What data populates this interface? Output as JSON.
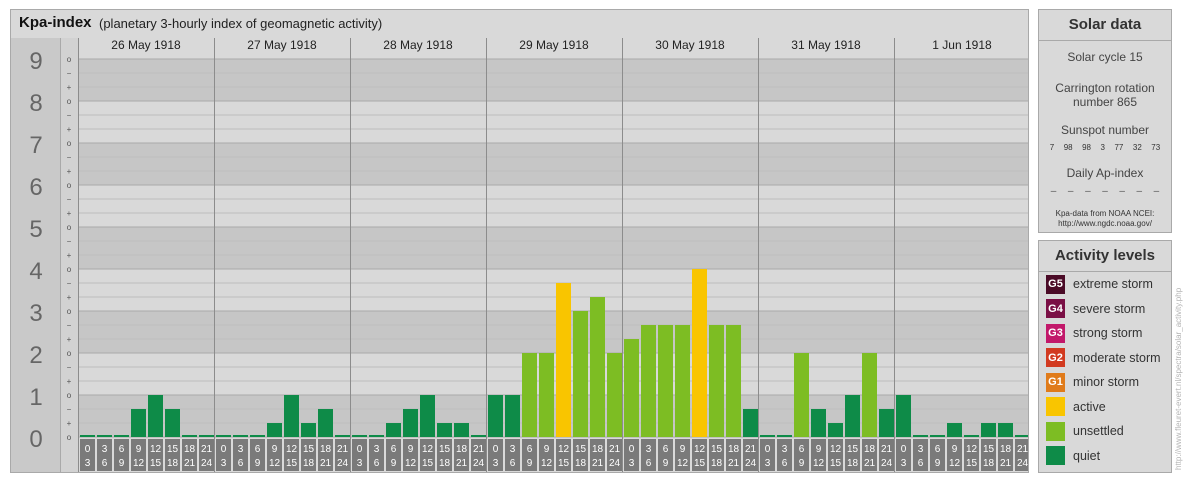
{
  "header": {
    "title": "Kpa-index",
    "subtitle": "(planetary 3-hourly index of geomagnetic activity)"
  },
  "chart_data": {
    "type": "bar",
    "title": "Kpa-index",
    "subtitle": "(planetary 3-hourly index of geomagnetic activity)",
    "ylim": [
      0,
      9
    ],
    "y_ticks": [
      "0",
      "1",
      "2",
      "3",
      "4",
      "5",
      "6",
      "7",
      "8",
      "9"
    ],
    "y_minor_ticks": [
      "o",
      "+",
      "−"
    ],
    "days": [
      "26 May 1918",
      "27 May 1918",
      "28 May 1918",
      "29 May 1918",
      "30 May 1918",
      "31 May 1918",
      "1 Jun 1918"
    ],
    "interval_labels": [
      [
        "0",
        "3"
      ],
      [
        "3",
        "6"
      ],
      [
        "6",
        "9"
      ],
      [
        "9",
        "12"
      ],
      [
        "12",
        "15"
      ],
      [
        "15",
        "18"
      ],
      [
        "18",
        "21"
      ],
      [
        "21",
        "24"
      ]
    ],
    "values": [
      [
        0,
        0,
        0,
        0.667,
        1,
        0.667,
        0,
        0
      ],
      [
        0,
        0,
        0,
        0.333,
        1,
        0.333,
        0.667,
        0
      ],
      [
        0,
        0,
        0.333,
        0.667,
        1,
        0.333,
        0.333,
        0
      ],
      [
        1,
        1,
        2,
        2,
        3.667,
        3,
        3.333,
        2
      ],
      [
        2.333,
        2.667,
        2.667,
        2.667,
        4,
        2.667,
        2.667,
        0.667
      ],
      [
        0,
        0,
        2,
        0.667,
        0.333,
        1,
        2,
        0.667
      ],
      [
        1,
        0,
        0,
        0.333,
        0,
        0.333,
        0.333,
        0
      ]
    ],
    "colors": {
      "quiet": "#0e8b48",
      "unsettled": "#7dbd23",
      "active": "#f9c500"
    },
    "grid": true
  },
  "solar": {
    "title": "Solar data",
    "cycle": "Solar cycle 15",
    "carrington_line1": "Carrington rotation",
    "carrington_line2": "number 865",
    "sunspot_label": "Sunspot number",
    "sunspot_values": [
      "7",
      "98",
      "98",
      "3",
      "77",
      "32",
      "73"
    ],
    "ap_label": "Daily Ap-index",
    "ap_values": [
      "–",
      "–",
      "–",
      "–",
      "–",
      "–",
      "–"
    ],
    "source_line1": "Kpa-data from NOAA NCEI:",
    "source_line2": "http://www.ngdc.noaa.gov/"
  },
  "activity": {
    "title": "Activity levels",
    "levels": [
      {
        "code": "G5",
        "label": "extreme storm",
        "color": "#4a0a26"
      },
      {
        "code": "G4",
        "label": "severe storm",
        "color": "#7a0f45"
      },
      {
        "code": "G3",
        "label": "strong storm",
        "color": "#c2186a"
      },
      {
        "code": "G2",
        "label": "moderate storm",
        "color": "#d23a20"
      },
      {
        "code": "G1",
        "label": "minor storm",
        "color": "#e07b1a"
      },
      {
        "code": "",
        "label": "active",
        "color": "#f9c500"
      },
      {
        "code": "",
        "label": "unsettled",
        "color": "#7dbd23"
      },
      {
        "code": "",
        "label": "quiet",
        "color": "#0e8b48"
      }
    ]
  },
  "watermark": "http://www.fleuret-evert.nl/spectra/solar_activity.php"
}
